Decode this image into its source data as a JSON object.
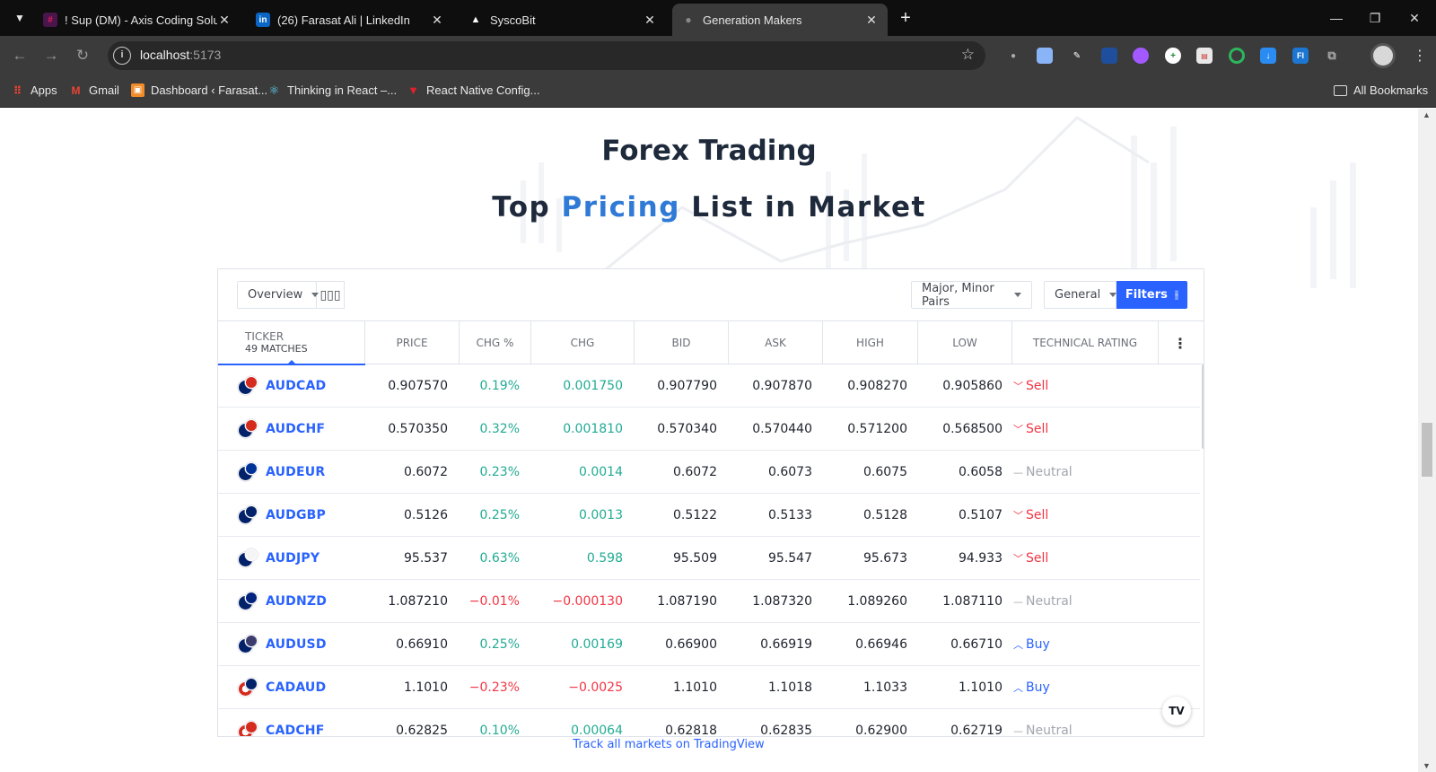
{
  "browser": {
    "tabs": [
      {
        "title": "! Sup (DM) - Axis Coding Soluti",
        "icon": "slack-icon",
        "color": "#e01e5a"
      },
      {
        "title": "(26) Farasat Ali | LinkedIn",
        "icon": "linkedin-icon",
        "color": "#0a66c2"
      },
      {
        "title": "SyscoBit",
        "icon": "triangle-icon",
        "color": "#ffffff"
      },
      {
        "title": "Generation Makers",
        "icon": "dot-icon",
        "color": "#777777"
      }
    ],
    "url_host": "localhost",
    "url_port": ":5173",
    "bookmarks": [
      {
        "label": "Apps",
        "icon": "apps-grid-icon"
      },
      {
        "label": "Gmail",
        "icon": "gmail-icon"
      },
      {
        "label": "Dashboard ‹ Farasat...",
        "icon": "dashboard-icon"
      },
      {
        "label": "Thinking in React –...",
        "icon": "react-icon"
      },
      {
        "label": "React Native Config...",
        "icon": "vue-icon"
      }
    ],
    "all_bookmarks": "All Bookmarks"
  },
  "page": {
    "heading": "Forex Trading",
    "subheading_pre": "Top ",
    "subheading_accent": "Pricing",
    "subheading_post": " List in Market",
    "accent_color": "#2f7ad7",
    "track_link": "Track all markets on TradingView"
  },
  "widget": {
    "view_select": "Overview",
    "pairs_select": "Major, Minor Pairs",
    "general_select": "General",
    "filters_button": "Filters",
    "columns": {
      "ticker": "TICKER",
      "matches": "49 MATCHES",
      "price": "PRICE",
      "chg_pct": "CHG %",
      "chg": "CHG",
      "bid": "BID",
      "ask": "ASK",
      "high": "HIGH",
      "low": "LOW",
      "rating": "TECHNICAL RATING"
    },
    "rows": [
      {
        "symbol": "AUDCAD",
        "price": "0.907570",
        "chg_pct": "0.19%",
        "chg": "0.001750",
        "bid": "0.907790",
        "ask": "0.907870",
        "high": "0.908270",
        "low": "0.905860",
        "rating": "Sell",
        "dir": "pos",
        "flag2": "#d52b1e"
      },
      {
        "symbol": "AUDCHF",
        "price": "0.570350",
        "chg_pct": "0.32%",
        "chg": "0.001810",
        "bid": "0.570340",
        "ask": "0.570440",
        "high": "0.571200",
        "low": "0.568500",
        "rating": "Sell",
        "dir": "pos",
        "flag2": "#d52b1e"
      },
      {
        "symbol": "AUDEUR",
        "price": "0.6072",
        "chg_pct": "0.23%",
        "chg": "0.0014",
        "bid": "0.6072",
        "ask": "0.6073",
        "high": "0.6075",
        "low": "0.6058",
        "rating": "Neutral",
        "dir": "pos",
        "flag2": "#003399"
      },
      {
        "symbol": "AUDGBP",
        "price": "0.5126",
        "chg_pct": "0.25%",
        "chg": "0.0013",
        "bid": "0.5122",
        "ask": "0.5133",
        "high": "0.5128",
        "low": "0.5107",
        "rating": "Sell",
        "dir": "pos",
        "flag2": "#012169"
      },
      {
        "symbol": "AUDJPY",
        "price": "95.537",
        "chg_pct": "0.63%",
        "chg": "0.598",
        "bid": "95.509",
        "ask": "95.547",
        "high": "95.673",
        "low": "94.933",
        "rating": "Sell",
        "dir": "pos",
        "flag2": "#f5f5f5"
      },
      {
        "symbol": "AUDNZD",
        "price": "1.087210",
        "chg_pct": "−0.01%",
        "chg": "−0.000130",
        "bid": "1.087190",
        "ask": "1.087320",
        "high": "1.089260",
        "low": "1.087110",
        "rating": "Neutral",
        "dir": "neg",
        "flag2": "#00247d"
      },
      {
        "symbol": "AUDUSD",
        "price": "0.66910",
        "chg_pct": "0.25%",
        "chg": "0.00169",
        "bid": "0.66900",
        "ask": "0.66919",
        "high": "0.66946",
        "low": "0.66710",
        "rating": "Buy",
        "dir": "pos",
        "flag2": "#3c3b6e"
      },
      {
        "symbol": "CADAUD",
        "price": "1.1010",
        "chg_pct": "−0.23%",
        "chg": "−0.0025",
        "bid": "1.1010",
        "ask": "1.1018",
        "high": "1.1033",
        "low": "1.1010",
        "rating": "Buy",
        "dir": "neg",
        "flag2": "#012169"
      },
      {
        "symbol": "CADCHF",
        "price": "0.62825",
        "chg_pct": "0.10%",
        "chg": "0.00064",
        "bid": "0.62818",
        "ask": "0.62835",
        "high": "0.62900",
        "low": "0.62719",
        "rating": "Neutral",
        "dir": "pos",
        "flag2": "#d52b1e"
      }
    ],
    "tv_logo": "TV"
  }
}
